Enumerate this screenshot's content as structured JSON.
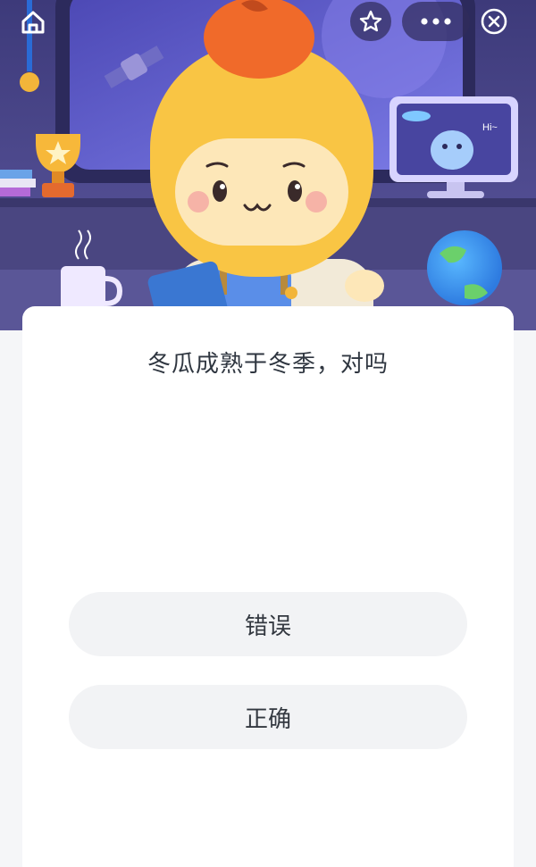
{
  "question": "冬瓜成熟于冬季，对吗",
  "answers": [
    "错误",
    "正确"
  ],
  "scene": {
    "monitor_text": "Hi~"
  },
  "top_bar": {
    "icons": [
      "home-icon",
      "star-icon",
      "more-icon",
      "close-icon"
    ]
  },
  "colors": {
    "scene_background": "#4b4785",
    "character_head": "#f9c544",
    "character_face": "#fde7b8",
    "apple": "#f06a2a",
    "card_background": "#ffffff",
    "button_background": "#f2f3f5",
    "page_background": "#f5f6f8"
  }
}
